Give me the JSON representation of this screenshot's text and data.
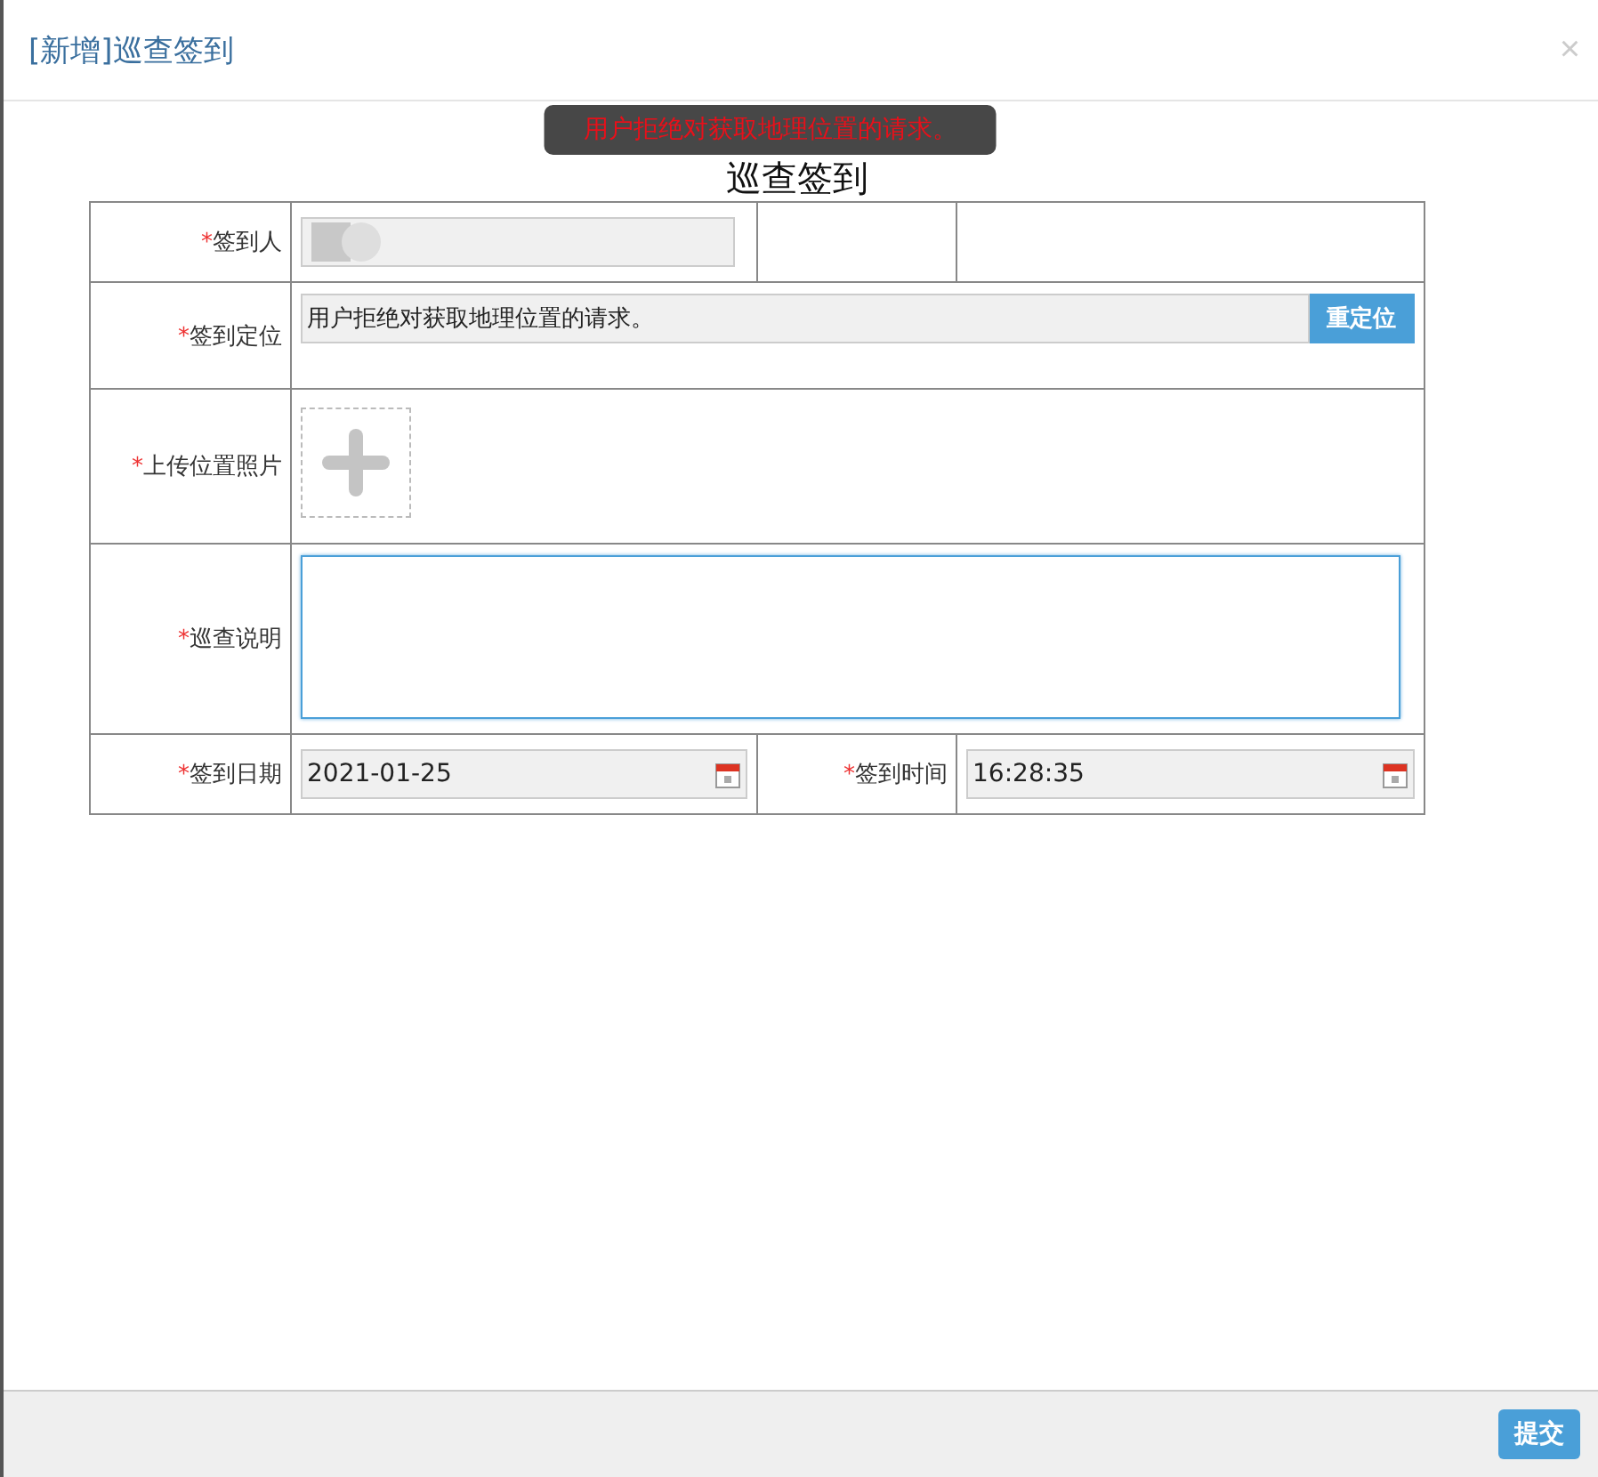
{
  "dialog": {
    "title": "[新增]巡查签到",
    "close": "×"
  },
  "form_title": "巡查签到",
  "toast": {
    "message": "用户拒绝对获取地理位置的请求。"
  },
  "fields": {
    "signer": {
      "label": "签到人",
      "required_mark": "*"
    },
    "location": {
      "label": "签到定位",
      "required_mark": "*",
      "value": "用户拒绝对获取地理位置的请求。",
      "button": "重定位"
    },
    "photo": {
      "label": "上传位置照片",
      "required_mark": "*"
    },
    "description": {
      "label": "巡查说明",
      "required_mark": "*",
      "focused": true
    },
    "date": {
      "label": "签到日期",
      "required_mark": "*",
      "value": "2021-01-25"
    },
    "time": {
      "label": "签到时间",
      "required_mark": "*",
      "value": "16:28:35"
    }
  },
  "footer": {
    "button": "提交"
  }
}
